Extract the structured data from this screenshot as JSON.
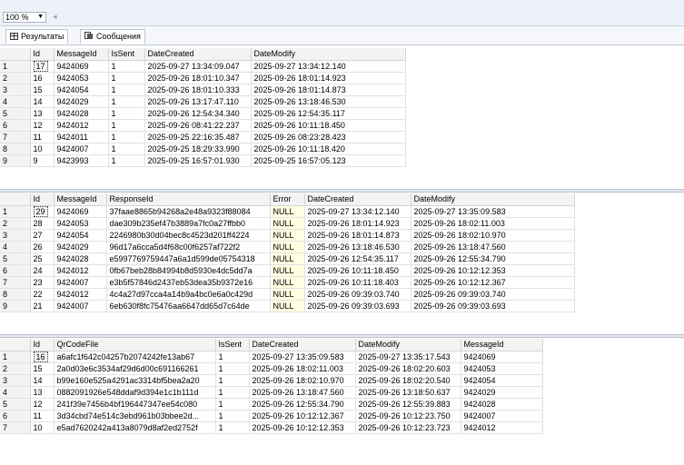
{
  "toolbar": {
    "zoom": "100 %"
  },
  "tabs": [
    {
      "label": "Результаты",
      "icon": "grid-icon"
    },
    {
      "label": "Сообщения",
      "icon": "messages-icon"
    }
  ],
  "grid1": {
    "columns": [
      "Id",
      "MessageId",
      "IsSent",
      "DateCreated",
      "DateModify"
    ],
    "rows": [
      [
        "1",
        "17",
        "9424069",
        "1",
        "2025-09-27 13:34:09.047",
        "2025-09-27 13:34:12.140"
      ],
      [
        "2",
        "16",
        "9424053",
        "1",
        "2025-09-26 18:01:10.347",
        "2025-09-26 18:01:14.923"
      ],
      [
        "3",
        "15",
        "9424054",
        "1",
        "2025-09-26 18:01:10.333",
        "2025-09-26 18:01:14.873"
      ],
      [
        "4",
        "14",
        "9424029",
        "1",
        "2025-09-26 13:17:47.110",
        "2025-09-26 13:18:46.530"
      ],
      [
        "5",
        "13",
        "9424028",
        "1",
        "2025-09-26 12:54:34.340",
        "2025-09-26 12:54:35.117"
      ],
      [
        "6",
        "12",
        "9424012",
        "1",
        "2025-09-26 08:41:22.237",
        "2025-09-26 10:11:18.450"
      ],
      [
        "7",
        "11",
        "9424011",
        "1",
        "2025-09-25 22:16:35.487",
        "2025-09-26 08:23:28.423"
      ],
      [
        "8",
        "10",
        "9424007",
        "1",
        "2025-09-25 18:29:33.990",
        "2025-09-26 10:11:18.420"
      ],
      [
        "9",
        "9",
        "9423993",
        "1",
        "2025-09-25 16:57:01.930",
        "2025-09-25 16:57:05.123"
      ]
    ]
  },
  "grid2": {
    "columns": [
      "Id",
      "MessageId",
      "ResponseId",
      "Error",
      "DateCreated",
      "DateModify"
    ],
    "rows": [
      [
        "1",
        "29",
        "9424069",
        "37faae8865b94268a2e48a9323f88084",
        "NULL",
        "2025-09-27 13:34:12.140",
        "2025-09-27 13:35:09.583"
      ],
      [
        "2",
        "28",
        "9424053",
        "dae309b235ef47b3889a7fc0a27ffbb0",
        "NULL",
        "2025-09-26 18:01:14.923",
        "2025-09-26 18:02:11.003"
      ],
      [
        "3",
        "27",
        "9424054",
        "2246980b30d04bec8c4523d201ff4224",
        "NULL",
        "2025-09-26 18:01:14.873",
        "2025-09-26 18:02:10.970"
      ],
      [
        "4",
        "26",
        "9424029",
        "96d17a6cca5d4f68c00f6257af722f2",
        "NULL",
        "2025-09-26 13:18:46.530",
        "2025-09-26 13:18:47.560"
      ],
      [
        "5",
        "25",
        "9424028",
        "e5997769759447a6a1d599de05754318",
        "NULL",
        "2025-09-26 12:54:35.117",
        "2025-09-26 12:55:34.790"
      ],
      [
        "6",
        "24",
        "9424012",
        "0fb67beb28b84994b8d5930e4dc5dd7a",
        "NULL",
        "2025-09-26 10:11:18.450",
        "2025-09-26 10:12:12.353"
      ],
      [
        "7",
        "23",
        "9424007",
        "e3b5f57846d2437eb53dea35b9372e16",
        "NULL",
        "2025-09-26 10:11:18.403",
        "2025-09-26 10:12:12.367"
      ],
      [
        "8",
        "22",
        "9424012",
        "4c4a27d97cca4a14b9a4bc0e6a0c429d",
        "NULL",
        "2025-09-26 09:39:03.740",
        "2025-09-26 09:39:03.740"
      ],
      [
        "9",
        "21",
        "9424007",
        "6eb630f8fc75476aa6647dd65d7c64de",
        "NULL",
        "2025-09-26 09:39:03.693",
        "2025-09-26 09:39:03.693"
      ]
    ]
  },
  "grid3": {
    "columns": [
      "Id",
      "QrCodeFile",
      "IsSent",
      "DateCreated",
      "DateModify",
      "MessageId"
    ],
    "rows": [
      [
        "1",
        "16",
        "a6afc1f642c04257b2074242fe13ab67",
        "1",
        "2025-09-27 13:35:09.583",
        "2025-09-27 13:35:17.543",
        "9424069"
      ],
      [
        "2",
        "15",
        "2a0d03e6c3534af29d6d00c691166261",
        "1",
        "2025-09-26 18:02:11.003",
        "2025-09-26 18:02:20.603",
        "9424053"
      ],
      [
        "3",
        "14",
        "b99e160e525a4291ac3314bf5bea2a20",
        "1",
        "2025-09-26 18:02:10.970",
        "2025-09-26 18:02:20.540",
        "9424054"
      ],
      [
        "4",
        "13",
        "0882091926e548ddaf9d394e1c1b111d",
        "1",
        "2025-09-26 13:18:47.560",
        "2025-09-26 13:18:50.637",
        "9424029"
      ],
      [
        "5",
        "12",
        "241f39e7456b4bf196447347ee54c080",
        "1",
        "2025-09-26 12:55:34.790",
        "2025-09-26 12:55:39.883",
        "9424028"
      ],
      [
        "6",
        "11",
        "3d34cbd74e514c3ebd961b03bbee2d...",
        "1",
        "2025-09-26 10:12:12.367",
        "2025-09-26 10:12:23.750",
        "9424007"
      ],
      [
        "7",
        "10",
        "e5ad7620242a413a8079d8af2ed2752f",
        "1",
        "2025-09-26 10:12:12.353",
        "2025-09-26 10:12:23.723",
        "9424012"
      ]
    ]
  }
}
